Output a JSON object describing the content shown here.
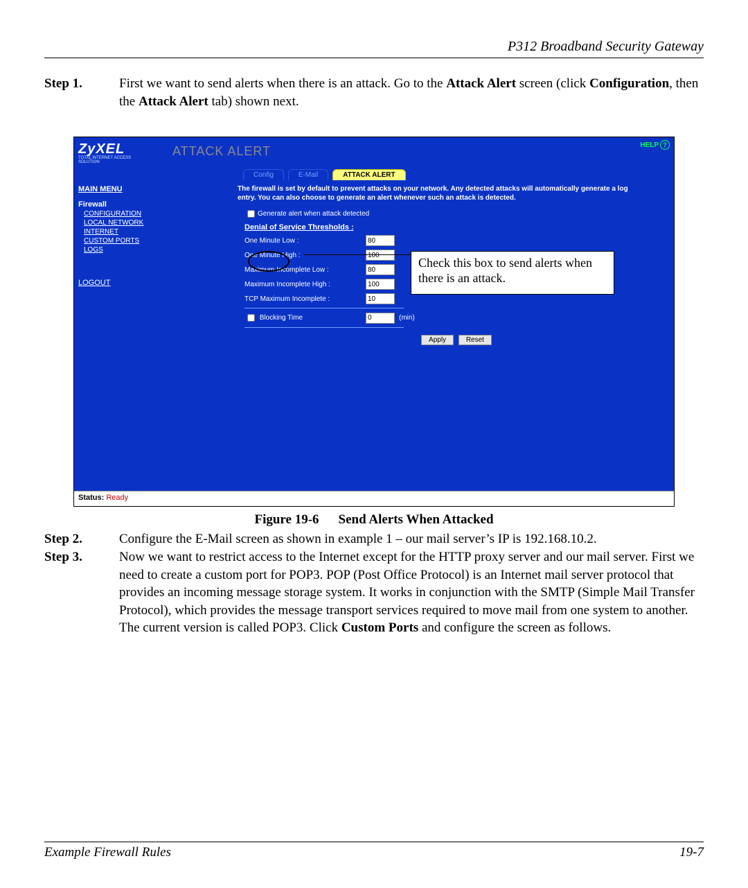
{
  "doc": {
    "header_title": "P312  Broadband Security Gateway",
    "footer_left": "Example Firewall Rules",
    "footer_right": "19-7"
  },
  "steps": {
    "s1": {
      "label": "Step 1.",
      "pre": "First we want to send alerts when there is an attack. Go to the ",
      "b1": "Attack Alert",
      "mid": " screen (click ",
      "b2": "Configuration",
      "mid2": ", then the ",
      "b3": "Attack Alert",
      "post": " tab) shown next."
    },
    "s2": {
      "label": "Step 2.",
      "text": "Configure the E-Mail screen as shown in example 1 – our mail server’s IP is 192.168.10.2."
    },
    "s3": {
      "label": "Step 3.",
      "p1": "Now we want to restrict access to the Internet except for the HTTP proxy server and our mail server. First we need to create a custom port for POP3. POP (Post Office Protocol) is an Internet mail server protocol that provides an incoming message storage system. It works in conjunction with the SMTP (Simple Mail Transfer Protocol), which provides the message transport services required to move mail from one system to another. The current version is called POP3. Click ",
      "b1": "Custom Ports",
      "p2": " and configure the screen as follows."
    }
  },
  "figure": {
    "num": "Figure 19-6",
    "caption": "Send Alerts When Attacked"
  },
  "shot": {
    "brand": "ZyXEL",
    "tagline": "TOTAL INTERNET ACCESS SOLUTION",
    "help": "HELP",
    "sidebar": {
      "main_menu": "MAIN MENU",
      "firewall": "Firewall",
      "links": {
        "configuration": "CONFIGURATION",
        "local_network": "LOCAL NETWORK",
        "internet": "INTERNET",
        "custom_ports": "CUSTOM PORTS",
        "logs": "LOGS"
      },
      "logout": "LOGOUT"
    },
    "panel_title": "ATTACK ALERT",
    "tabs": {
      "config": "Config",
      "email": "E-Mail",
      "attack_alert": "ATTACK ALERT"
    },
    "intro": "The firewall is set by default to prevent attacks on your network. Any detected attacks will automatically generate a log entry. You can also choose to generate an alert whenever such an attack is detected.",
    "generate_alert": "Generate alert when attack detected",
    "dos_heading": "Denial of Service Thresholds :",
    "fields": {
      "one_min_low": {
        "label": "One Minute Low :",
        "value": "80"
      },
      "one_min_high": {
        "label": "One Minute High :",
        "value": "100"
      },
      "max_inc_low": {
        "label": "Maximum Incomplete Low :",
        "value": "80"
      },
      "max_inc_high": {
        "label": "Maximum Incomplete High :",
        "value": "100"
      },
      "tcp_max_inc": {
        "label": "TCP Maximum Incomplete :",
        "value": "10"
      },
      "blocking_time": {
        "label": "Blocking Time",
        "value": "0",
        "unit": "(min)"
      }
    },
    "buttons": {
      "apply": "Apply",
      "reset": "Reset"
    },
    "callout": "Check this box to send alerts when there is an attack.",
    "status_label": "Status:",
    "status_value": "Ready"
  }
}
